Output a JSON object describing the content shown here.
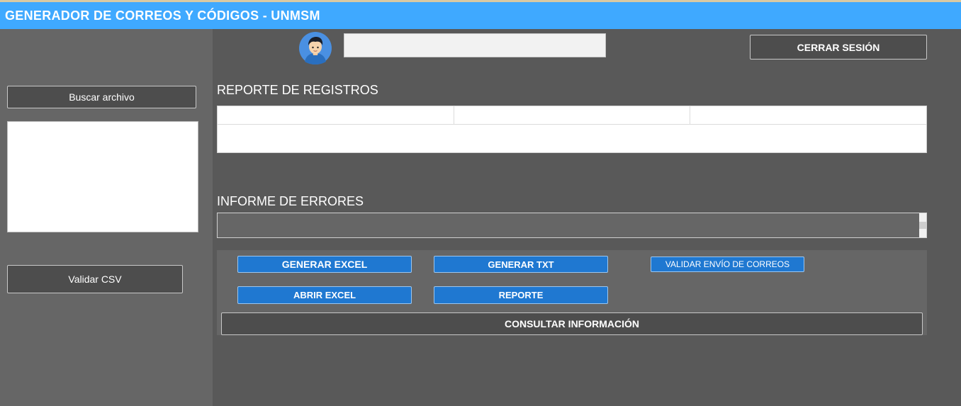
{
  "window": {
    "title": "GENERADOR DE CORREOS Y CÓDIGOS - UNMSM"
  },
  "header": {
    "user_value": "",
    "logout_label": "CERRAR SESIÓN"
  },
  "sidebar": {
    "browse_label": "Buscar archivo",
    "validate_csv_label": "Validar CSV",
    "file_list": []
  },
  "report": {
    "title": "REPORTE DE REGISTROS",
    "columns": [
      "",
      "",
      ""
    ],
    "rows": []
  },
  "errors": {
    "title": "INFORME DE ERRORES",
    "text": ""
  },
  "actions": {
    "generate_excel": "GENERAR EXCEL",
    "generate_txt": "GENERAR TXT",
    "validate_email": "VALIDAR ENVÍO DE CORREOS",
    "open_excel": "ABRIR EXCEL",
    "report": "REPORTE",
    "consult": "CONSULTAR INFORMACIÓN"
  },
  "icons": {
    "avatar": "user-avatar-icon"
  },
  "colors": {
    "titlebar": "#3fa9ff",
    "accent_button": "#1f78d1",
    "background": "#595959",
    "sidebar": "#666666"
  }
}
